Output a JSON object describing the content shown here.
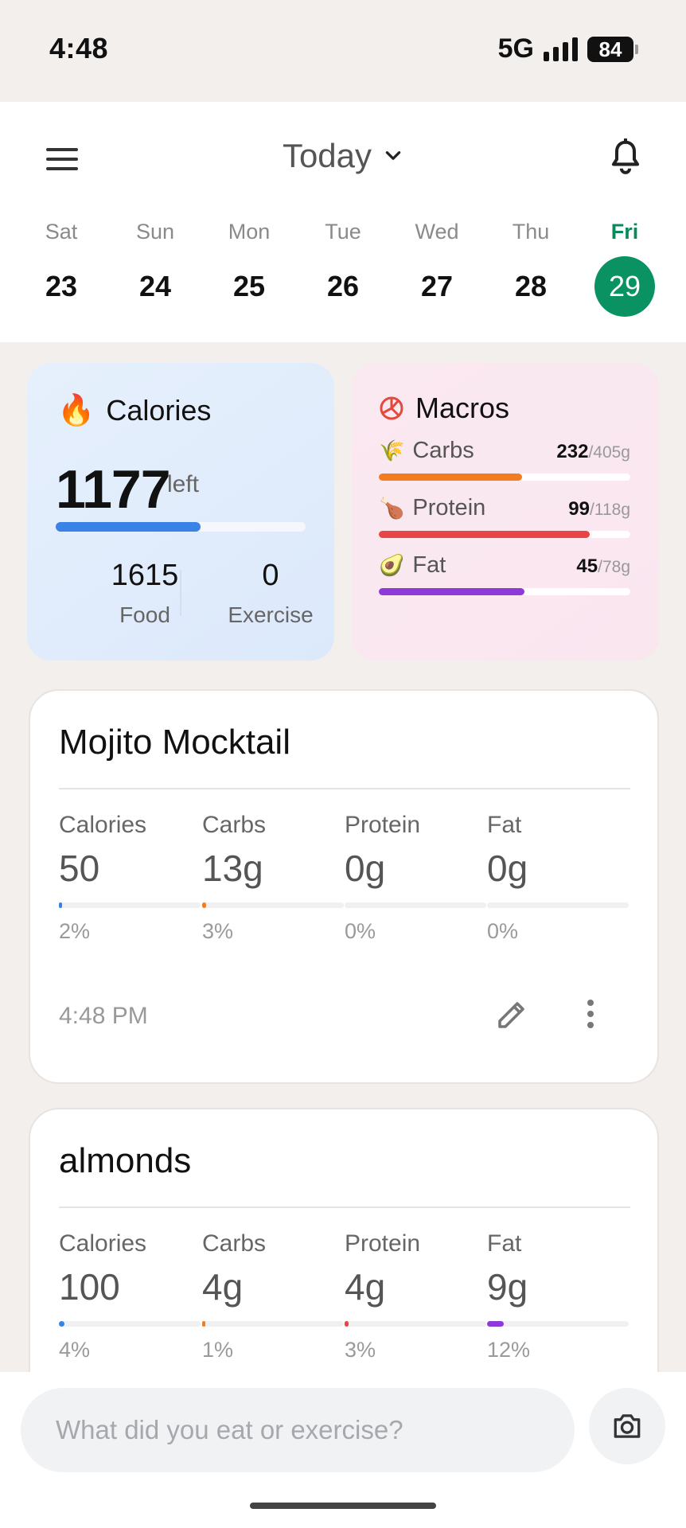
{
  "status_bar": {
    "time": "4:48",
    "network": "5G",
    "battery": "84"
  },
  "header": {
    "title": "Today",
    "menu_icon": "menu-icon",
    "bell_icon": "bell-icon"
  },
  "week": [
    {
      "name": "Sat",
      "date": "23",
      "active": false
    },
    {
      "name": "Sun",
      "date": "24",
      "active": false
    },
    {
      "name": "Mon",
      "date": "25",
      "active": false
    },
    {
      "name": "Tue",
      "date": "26",
      "active": false
    },
    {
      "name": "Wed",
      "date": "27",
      "active": false
    },
    {
      "name": "Thu",
      "date": "28",
      "active": false
    },
    {
      "name": "Fri",
      "date": "29",
      "active": true
    }
  ],
  "calories": {
    "title": "Calories",
    "icon": "🔥",
    "left": "1177",
    "left_label": "left",
    "progress": 0.58,
    "food_value": "1615",
    "food_label": "Food",
    "exercise_value": "0",
    "exercise_label": "Exercise",
    "accent": "#3b82e6"
  },
  "macros": {
    "title": "Macros",
    "items": [
      {
        "icon": "🌾",
        "label": "Carbs",
        "value": "232",
        "goal": "/405g",
        "progress": 0.57,
        "color": "#f47c20"
      },
      {
        "icon": "🍗",
        "label": "Protein",
        "value": "99",
        "goal": "/118g",
        "progress": 0.84,
        "color": "#e84545"
      },
      {
        "icon": "🥑",
        "label": "Fat",
        "value": "45",
        "goal": "/78g",
        "progress": 0.58,
        "color": "#8e3ad9"
      }
    ]
  },
  "entries": [
    {
      "name": "Mojito Mocktail",
      "time": "4:48 PM",
      "nutrients": [
        {
          "label": "Calories",
          "value": "50",
          "pct": "2%",
          "progress": 0.02,
          "color": "#3b82e6"
        },
        {
          "label": "Carbs",
          "value": "13g",
          "pct": "3%",
          "progress": 0.03,
          "color": "#f47c20"
        },
        {
          "label": "Protein",
          "value": "0g",
          "pct": "0%",
          "progress": 0.0,
          "color": "#e84545"
        },
        {
          "label": "Fat",
          "value": "0g",
          "pct": "0%",
          "progress": 0.0,
          "color": "#8e3ad9"
        }
      ]
    },
    {
      "name": "almonds",
      "nutrients": [
        {
          "label": "Calories",
          "value": "100",
          "pct": "4%",
          "progress": 0.04,
          "color": "#3b82e6"
        },
        {
          "label": "Carbs",
          "value": "4g",
          "pct": "1%",
          "progress": 0.01,
          "color": "#f47c20"
        },
        {
          "label": "Protein",
          "value": "4g",
          "pct": "3%",
          "progress": 0.03,
          "color": "#e84545"
        },
        {
          "label": "Fat",
          "value": "9g",
          "pct": "12%",
          "progress": 0.12,
          "color": "#8e3ad9"
        }
      ]
    }
  ],
  "composer": {
    "placeholder": "What did you eat or exercise?",
    "camera_icon": "camera-icon"
  }
}
